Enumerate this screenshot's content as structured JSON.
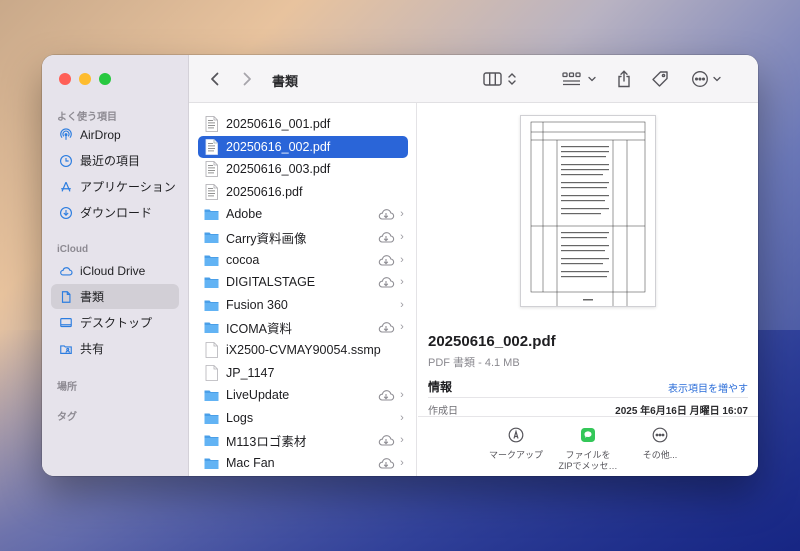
{
  "colors": {
    "accent": "#2a65d8",
    "link": "#2a6cd8"
  },
  "toolbar": {
    "title": "書類"
  },
  "sidebar": {
    "favorites_heading": "よく使う項目",
    "favorites": [
      {
        "label": "AirDrop",
        "icon": "airdrop-icon"
      },
      {
        "label": "最近の項目",
        "icon": "clock-icon"
      },
      {
        "label": "アプリケーション",
        "icon": "app-store-icon"
      },
      {
        "label": "ダウンロード",
        "icon": "download-icon"
      }
    ],
    "icloud_heading": "iCloud",
    "icloud": [
      {
        "label": "iCloud Drive",
        "icon": "cloud-icon"
      },
      {
        "label": "書類",
        "icon": "document-icon"
      },
      {
        "label": "デスクトップ",
        "icon": "desktop-icon"
      },
      {
        "label": "共有",
        "icon": "shared-folder-icon"
      }
    ],
    "locations_heading": "場所",
    "tags_heading": "タグ"
  },
  "files": [
    {
      "name": "20250616_001.pdf",
      "type": "pdf"
    },
    {
      "name": "20250616_002.pdf",
      "type": "pdf",
      "selected": true
    },
    {
      "name": "20250616_003.pdf",
      "type": "pdf"
    },
    {
      "name": "20250616.pdf",
      "type": "pdf"
    },
    {
      "name": "Adobe",
      "type": "folder",
      "cloud": true
    },
    {
      "name": "Carry資料画像",
      "type": "folder",
      "cloud": true
    },
    {
      "name": "cocoa",
      "type": "folder",
      "cloud": true
    },
    {
      "name": "DIGITALSTAGE",
      "type": "folder",
      "cloud": true
    },
    {
      "name": "Fusion 360",
      "type": "folder",
      "cloud": false
    },
    {
      "name": "ICOMA資料",
      "type": "folder",
      "cloud": true
    },
    {
      "name": "iX2500-CVMAY90054.ssmp",
      "type": "file"
    },
    {
      "name": "JP_1147",
      "type": "file"
    },
    {
      "name": "LiveUpdate",
      "type": "folder",
      "cloud": true
    },
    {
      "name": "Logs",
      "type": "folder",
      "cloud": false
    },
    {
      "name": "M113ロゴ素材",
      "type": "folder",
      "cloud": true
    },
    {
      "name": "Mac Fan",
      "type": "folder",
      "cloud": true
    }
  ],
  "preview": {
    "filename": "20250616_002.pdf",
    "subtitle": "PDF 書類 - 4.1 MB",
    "info_heading": "情報",
    "show_more": "表示項目を増やす",
    "created_label": "作成日",
    "created_value": "2025 年6月16日 月曜日 16:07",
    "actions": [
      {
        "label": "マークアップ",
        "icon": "markup-icon"
      },
      {
        "label": "ファイルを\nZIPでメッセ…",
        "icon": "messages-icon"
      },
      {
        "label": "その他...",
        "icon": "more-icon"
      }
    ]
  }
}
